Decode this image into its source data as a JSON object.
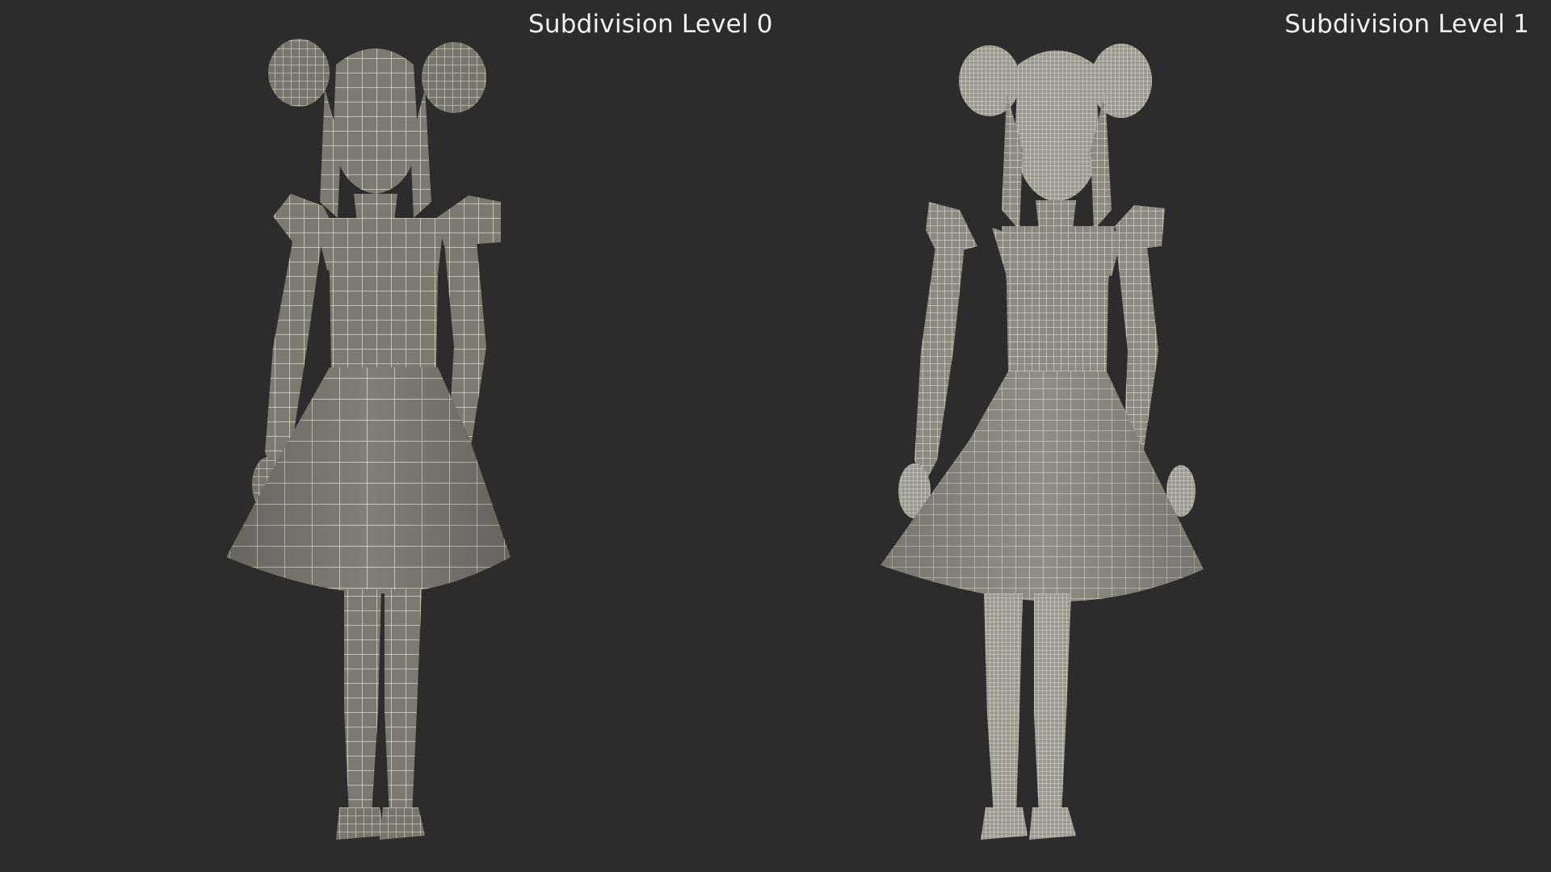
{
  "viewport": {
    "background": "#2c2c2c",
    "wire_color": "#e8e6d6",
    "surface_color": "#7c7c72"
  },
  "panels": [
    {
      "label": "Subdivision Level 0",
      "model": "girl-in-dress-wireframe",
      "mesh_density": "coarse"
    },
    {
      "label": "Subdivision Level 1",
      "model": "girl-in-dress-wireframe",
      "mesh_density": "fine"
    }
  ]
}
